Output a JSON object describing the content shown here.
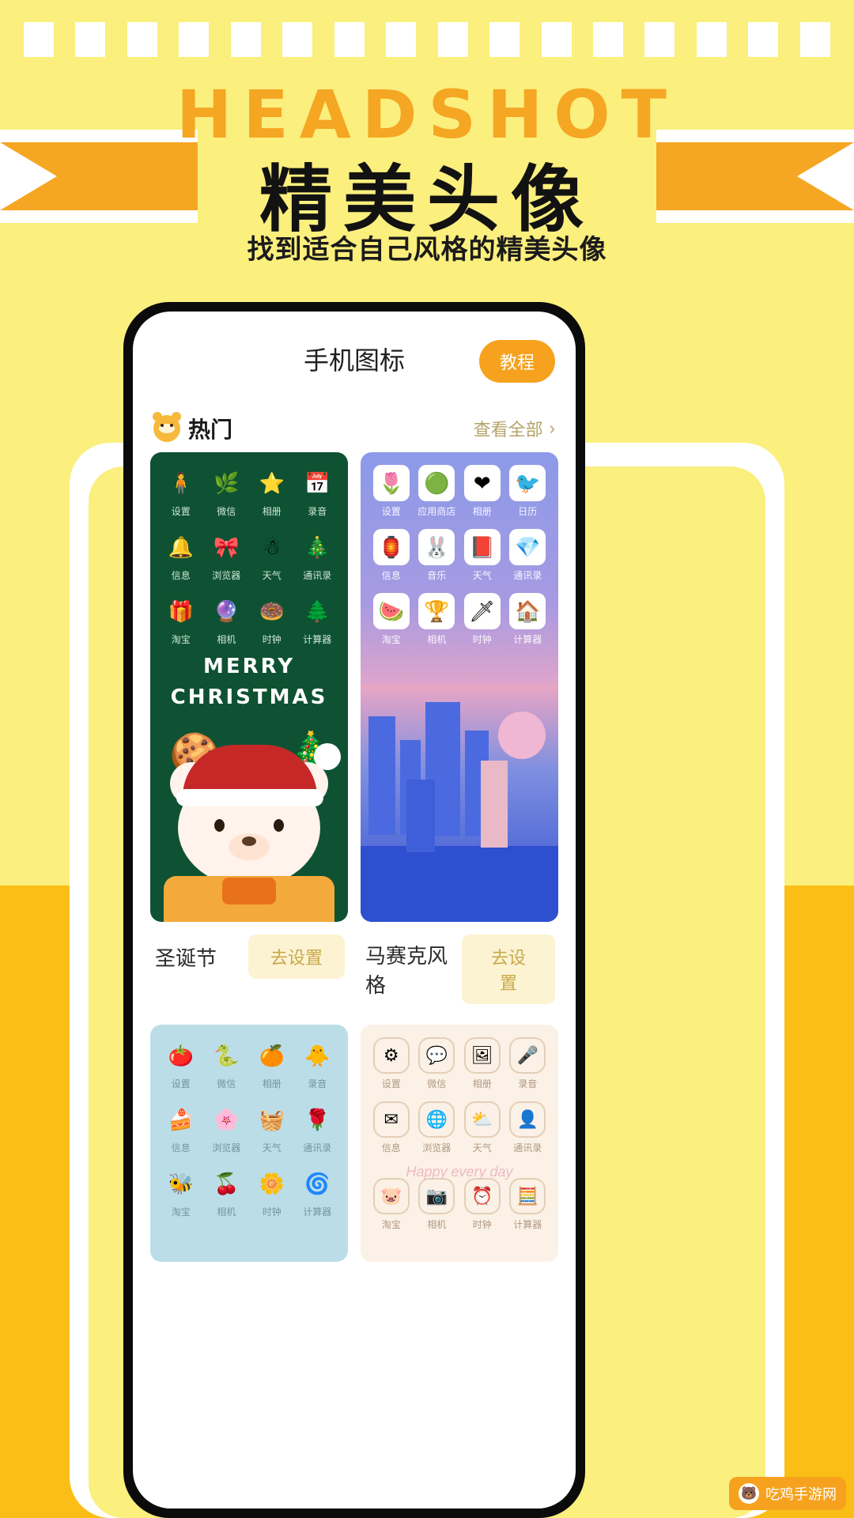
{
  "poster": {
    "headline_en": "HEADSHOT",
    "headline_cn": "精美头像",
    "subtitle": "找到适合自己风格的精美头像",
    "accent_orange": "#F5A623",
    "background_yellow": "#FBEF7E",
    "bottom_orange": "#FBBE16"
  },
  "app": {
    "title": "手机图标",
    "tutorial_button": "教程",
    "section": {
      "icon": "bear-icon",
      "title": "热门",
      "see_all": "查看全部",
      "chevron": "›"
    },
    "cards": [
      {
        "name": "圣诞节",
        "action": "去设置",
        "theme": "xmas",
        "caption_line1": "MERRY",
        "caption_line2": "CHRISTMAS",
        "icons": [
          {
            "label": "设置",
            "glyph": "🧍"
          },
          {
            "label": "微信",
            "glyph": "🌿"
          },
          {
            "label": "相册",
            "glyph": "⭐"
          },
          {
            "label": "录音",
            "glyph": "📅"
          },
          {
            "label": "信息",
            "glyph": "🔔"
          },
          {
            "label": "浏览器",
            "glyph": "🎀"
          },
          {
            "label": "天气",
            "glyph": "☃"
          },
          {
            "label": "通讯录",
            "glyph": "🎄"
          },
          {
            "label": "淘宝",
            "glyph": "🎁"
          },
          {
            "label": "相机",
            "glyph": "🔮"
          },
          {
            "label": "时钟",
            "glyph": "🍩"
          },
          {
            "label": "计算器",
            "glyph": "🌲"
          }
        ]
      },
      {
        "name": "马赛克风格",
        "action": "去设置",
        "theme": "mosaic",
        "icons": [
          {
            "label": "设置",
            "glyph": "🌷"
          },
          {
            "label": "应用商店",
            "glyph": "🟢"
          },
          {
            "label": "相册",
            "glyph": "❤"
          },
          {
            "label": "日历",
            "glyph": "🐦"
          },
          {
            "label": "信息",
            "glyph": "🏮"
          },
          {
            "label": "音乐",
            "glyph": "🐰"
          },
          {
            "label": "天气",
            "glyph": "📕"
          },
          {
            "label": "通讯录",
            "glyph": "💎"
          },
          {
            "label": "淘宝",
            "glyph": "🍉"
          },
          {
            "label": "相机",
            "glyph": "🏆"
          },
          {
            "label": "时钟",
            "glyph": "🗡"
          },
          {
            "label": "计算器",
            "glyph": "🏠"
          }
        ]
      },
      {
        "name": "",
        "action": "",
        "theme": "pastel",
        "icons": [
          {
            "label": "设置",
            "glyph": "🍅"
          },
          {
            "label": "微信",
            "glyph": "🐍"
          },
          {
            "label": "相册",
            "glyph": "🍊"
          },
          {
            "label": "录音",
            "glyph": "🐥"
          },
          {
            "label": "信息",
            "glyph": "🍰"
          },
          {
            "label": "浏览器",
            "glyph": "🌸"
          },
          {
            "label": "天气",
            "glyph": "🧺"
          },
          {
            "label": "通讯录",
            "glyph": "🌹"
          },
          {
            "label": "淘宝",
            "glyph": "🐝"
          },
          {
            "label": "相机",
            "glyph": "🍒"
          },
          {
            "label": "时钟",
            "glyph": "🌼"
          },
          {
            "label": "计算器",
            "glyph": "🌀"
          }
        ]
      },
      {
        "name": "",
        "action": "",
        "theme": "beige",
        "caption": "Happy every day",
        "icons": [
          {
            "label": "设置",
            "glyph": "⚙"
          },
          {
            "label": "微信",
            "glyph": "💬"
          },
          {
            "label": "相册",
            "glyph": "🖼"
          },
          {
            "label": "录音",
            "glyph": "🎤"
          },
          {
            "label": "信息",
            "glyph": "✉"
          },
          {
            "label": "浏览器",
            "glyph": "🌐"
          },
          {
            "label": "天气",
            "glyph": "⛅"
          },
          {
            "label": "通讯录",
            "glyph": "👤"
          },
          {
            "label": "淘宝",
            "glyph": "🐷"
          },
          {
            "label": "相机",
            "glyph": "📷"
          },
          {
            "label": "时钟",
            "glyph": "⏰"
          },
          {
            "label": "计算器",
            "glyph": "🧮"
          }
        ]
      }
    ]
  },
  "watermark": {
    "text": "吃鸡手游网",
    "badge": "🐻"
  }
}
